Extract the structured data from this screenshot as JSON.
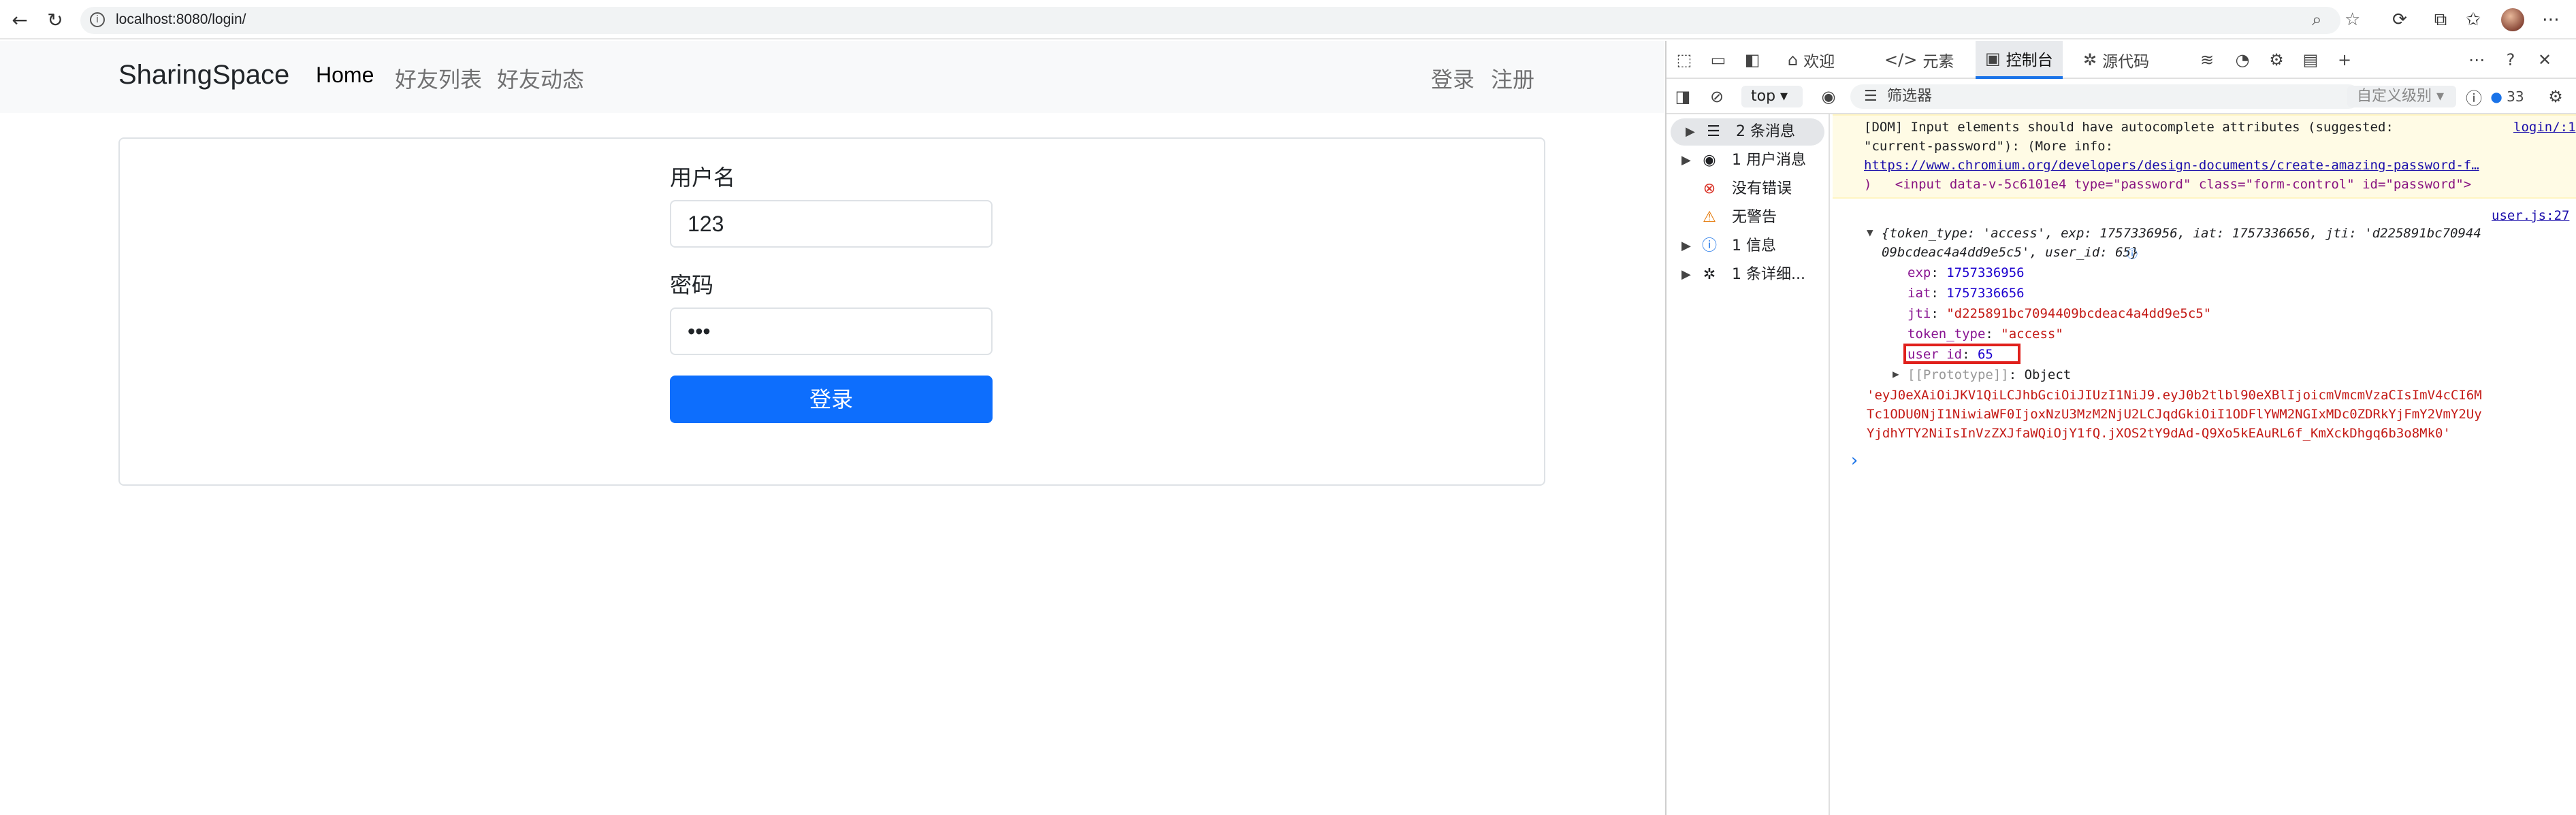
{
  "browser": {
    "url": "localhost:8080/login/"
  },
  "site": {
    "brand": "SharingSpace",
    "nav_links": [
      "Home",
      "好友列表",
      "好友动态"
    ],
    "right_links": [
      "登录",
      "注册"
    ]
  },
  "login_form": {
    "username_label": "用户名",
    "username_value": "123",
    "password_label": "密码",
    "password_value": "•••",
    "submit_label": "登录"
  },
  "devtools": {
    "tabs": [
      {
        "label": "欢迎",
        "icon": "home-icon"
      },
      {
        "label": "元素",
        "icon": "code-icon"
      },
      {
        "label": "控制台",
        "icon": "console-icon"
      },
      {
        "label": "源代码",
        "icon": "bug-icon"
      }
    ],
    "context": "top",
    "filter_placeholder": "筛选器",
    "levels": "自定义级别",
    "issue_count": "33",
    "sidebar": [
      {
        "label": "2 条消息",
        "icon": "list-icon"
      },
      {
        "label": "1 用户消息",
        "icon": "user-icon"
      },
      {
        "label": "没有错误",
        "icon": "error-icon"
      },
      {
        "label": "无警告",
        "icon": "warning-icon"
      },
      {
        "label": "1 信息",
        "icon": "info-icon"
      },
      {
        "label": "1 条详细...",
        "icon": "bug-icon"
      }
    ],
    "warning": {
      "line1": "[DOM] Input elements should have autocomplete attributes (suggested:",
      "line2": "\"current-password\"): (More info:",
      "link": "https://www.chromium.org/developers/design-documents/create-amazing-password-f…",
      "line4": ")   <input data-v-5c6101e4 type=\"password\" class=\"form-control\" id=\"password\">",
      "source": "login/:1"
    },
    "log": {
      "source": "user.js:27",
      "summary_line1": "{token_type: 'access', exp: 1757336956, iat: 1757336656, jti: 'd225891bc70944",
      "summary_line2": "09bcdeac4a4dd9e5c5', user_id: 65}",
      "fields": [
        {
          "key": "exp",
          "value": "1757336956"
        },
        {
          "key": "iat",
          "value": "1757336656"
        },
        {
          "key": "jti",
          "value": "\"d225891bc7094409bcdeac4a4dd9e5c5\""
        },
        {
          "key": "token_type",
          "value": "\"access\""
        },
        {
          "key": "user_id",
          "value": "65"
        }
      ],
      "prototype_label": "[[Prototype]]",
      "prototype_value": "Object",
      "token_line1": "'eyJ0eXAiOiJKV1QiLCJhbGciOiJIUzI1NiJ9.eyJ0b2tlbl90eXBlIjoicmVmcmVzaCIsImV4cCI6M",
      "token_line2": "Tc1ODU0NjI1NiwiaWF0IjoxNzU3MzM2NjU2LCJqdGkiOiI1ODFlYWM2NGIxMDc0ZDRkYjFmY2VmY2Uy",
      "token_line3": "YjdhYTY2NiIsInVzZXJfaWQiOjY1fQ.jXOS2tY9dAd-Q9Xo5kEAuRL6f_KmXckDhgq6b3o8Mk0'"
    }
  }
}
